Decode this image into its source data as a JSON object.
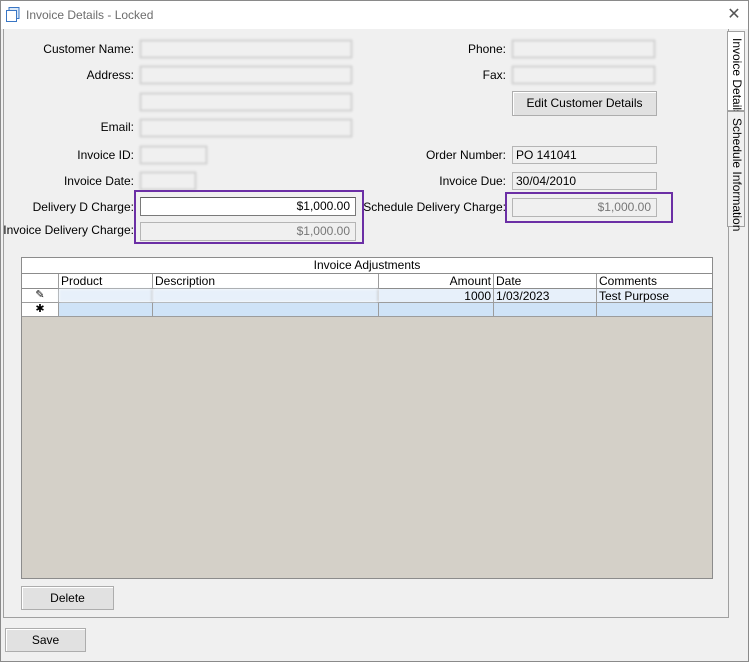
{
  "window": {
    "title": "Invoice Details - Locked",
    "close_glyph": "✕"
  },
  "tabs": [
    "Invoice Details",
    "Schedule Information"
  ],
  "form": {
    "customer_name_label": "Customer Name:",
    "customer_name_value": "",
    "address_label": "Address:",
    "address_line1": "",
    "address_line2": "",
    "email_label": "Email:",
    "email_value": "",
    "phone_label": "Phone:",
    "phone_value": "",
    "fax_label": "Fax:",
    "fax_value": "",
    "edit_customer_button": "Edit Customer Details",
    "invoice_id_label": "Invoice ID:",
    "invoice_id_value": "",
    "order_number_label": "Order Number:",
    "order_number_value": "PO 141041",
    "invoice_date_label": "Invoice Date:",
    "invoice_date_value": "",
    "invoice_due_label": "Invoice Due:",
    "invoice_due_value": "30/04/2010",
    "delivery_d_charge_label": "Delivery D Charge:",
    "delivery_d_charge_value": "$1,000.00",
    "invoice_delivery_charge_label": "Invoice Delivery Charge:",
    "invoice_delivery_charge_value": "$1,000.00",
    "schedule_delivery_charge_label": "Schedule Delivery Charge:",
    "schedule_delivery_charge_value": "$1,000.00"
  },
  "adjustments": {
    "caption": "Invoice Adjustments",
    "columns": [
      "Product",
      "Description",
      "Amount",
      "Date",
      "Comments"
    ],
    "rows": [
      {
        "indicator": "✎",
        "product": "",
        "description": "",
        "amount": "1000",
        "date": "1/03/2023",
        "comments": "Test Purpose"
      }
    ],
    "new_row_indicator": "✱"
  },
  "buttons": {
    "delete": "Delete",
    "save": "Save"
  },
  "colors": {
    "highlight": "#6b2fa5",
    "selected_row": "#cfe3f7",
    "grid_background": "#d4d0c8"
  },
  "icons": {
    "app": "window-icon",
    "close": "close-icon",
    "edit_row": "pencil-icon",
    "new_row": "asterisk-icon"
  }
}
